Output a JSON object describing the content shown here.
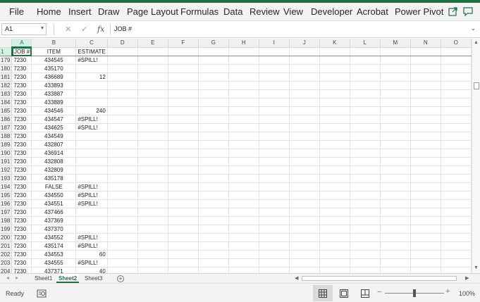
{
  "ribbon": {
    "tabs": [
      "File",
      "Home",
      "Insert",
      "Draw",
      "Page Layout",
      "Formulas",
      "Data",
      "Review",
      "View",
      "Developer",
      "Acrobat",
      "Power Pivot"
    ],
    "share_icon": "share-icon",
    "comments_icon": "comment-icon",
    "accent_color": "#1e7145"
  },
  "formula_bar": {
    "name_box": "A1",
    "cancel_icon": "✕",
    "enter_icon": "✓",
    "fx_label": "fx",
    "content": "JOB #",
    "expand_icon": "⌄"
  },
  "grid": {
    "columns": [
      "A",
      "B",
      "C",
      "D",
      "E",
      "F",
      "G",
      "H",
      "I",
      "J",
      "K",
      "L",
      "M",
      "N",
      "O"
    ],
    "header_row": {
      "row": "1",
      "a": "JOB #",
      "b": "ITEM",
      "c": "ESTIMATE"
    },
    "rows": [
      {
        "row": "179",
        "a": "7230",
        "b": "434545",
        "c": "#SPILL!"
      },
      {
        "row": "180",
        "a": "7230",
        "b": "435170",
        "c": ""
      },
      {
        "row": "181",
        "a": "7230",
        "b": "436689",
        "c": "12"
      },
      {
        "row": "182",
        "a": "7230",
        "b": "433893",
        "c": ""
      },
      {
        "row": "183",
        "a": "7230",
        "b": "433887",
        "c": ""
      },
      {
        "row": "184",
        "a": "7230",
        "b": "433889",
        "c": ""
      },
      {
        "row": "185",
        "a": "7230",
        "b": "434546",
        "c": "240"
      },
      {
        "row": "186",
        "a": "7230",
        "b": "434547",
        "c": "#SPILL!"
      },
      {
        "row": "187",
        "a": "7230",
        "b": "434625",
        "c": "#SPILL!"
      },
      {
        "row": "188",
        "a": "7230",
        "b": "434549",
        "c": ""
      },
      {
        "row": "189",
        "a": "7230",
        "b": "432807",
        "c": ""
      },
      {
        "row": "190",
        "a": "7230",
        "b": "436914",
        "c": ""
      },
      {
        "row": "191",
        "a": "7230",
        "b": "432808",
        "c": ""
      },
      {
        "row": "192",
        "a": "7230",
        "b": "432809",
        "c": ""
      },
      {
        "row": "193",
        "a": "7230",
        "b": "435178",
        "c": ""
      },
      {
        "row": "194",
        "a": "7230",
        "b": "FALSE",
        "c": "#SPILL!"
      },
      {
        "row": "195",
        "a": "7230",
        "b": "434550",
        "c": "#SPILL!"
      },
      {
        "row": "196",
        "a": "7230",
        "b": "434551",
        "c": "#SPILL!"
      },
      {
        "row": "197",
        "a": "7230",
        "b": "437466",
        "c": ""
      },
      {
        "row": "198",
        "a": "7230",
        "b": "437369",
        "c": ""
      },
      {
        "row": "199",
        "a": "7230",
        "b": "437370",
        "c": ""
      },
      {
        "row": "200",
        "a": "7230",
        "b": "434552",
        "c": "#SPILL!"
      },
      {
        "row": "201",
        "a": "7230",
        "b": "435174",
        "c": "#SPILL!"
      },
      {
        "row": "202",
        "a": "7230",
        "b": "434553",
        "c": "60"
      },
      {
        "row": "203",
        "a": "7230",
        "b": "434555",
        "c": "#SPILL!"
      },
      {
        "row": "204",
        "a": "7230",
        "b": "437371",
        "c": "40"
      }
    ]
  },
  "sheets": {
    "tabs": [
      "Sheet1",
      "Sheet2",
      "Sheet3"
    ],
    "active": "Sheet2",
    "add_label": "+"
  },
  "status": {
    "ready": "Ready",
    "zoom_minus": "−",
    "zoom_plus": "+",
    "zoom": "100%"
  }
}
